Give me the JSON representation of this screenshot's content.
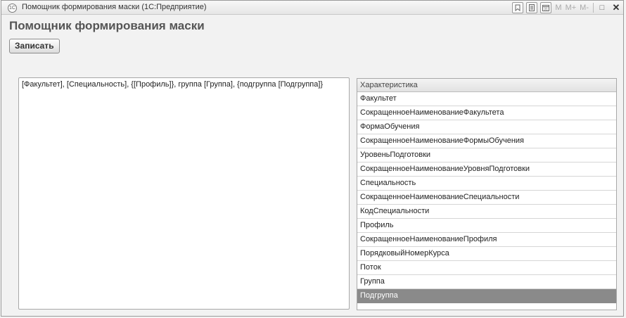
{
  "window": {
    "title": "Помощник формирования маски  (1С:Предприятие)",
    "app_icon": "1С"
  },
  "toolbar": {
    "m_label": "M",
    "m_plus_label": "M+",
    "m_minus_label": "M-",
    "close_glyph": "✕",
    "restore_glyph": "□"
  },
  "form": {
    "title": "Помощник формирования маски",
    "save_label": "Записать"
  },
  "mask": {
    "value": "[Факультет], [Специальность], {[Профиль]}, группа [Группа], {подгруппа [Подгруппа]}"
  },
  "characteristics": {
    "header": "Характеристика",
    "items": [
      "Факультет",
      "СокращенноеНаименованиеФакультета",
      "ФормаОбучения",
      "СокращенноеНаименованиеФормыОбучения",
      "УровеньПодготовки",
      "СокращенноеНаименованиеУровняПодготовки",
      "Специальность",
      "СокращенноеНаименованиеСпециальности",
      "КодСпециальности",
      "Профиль",
      "СокращенноеНаименованиеПрофиля",
      "ПорядковыйНомерКурса",
      "Поток",
      "Группа",
      "Подгруппа"
    ],
    "selected_index": 14
  },
  "icons": {
    "app": "app-1c-icon",
    "favorite": "favorite-icon",
    "calculator": "calculator-icon",
    "calendar": "calendar-icon"
  }
}
